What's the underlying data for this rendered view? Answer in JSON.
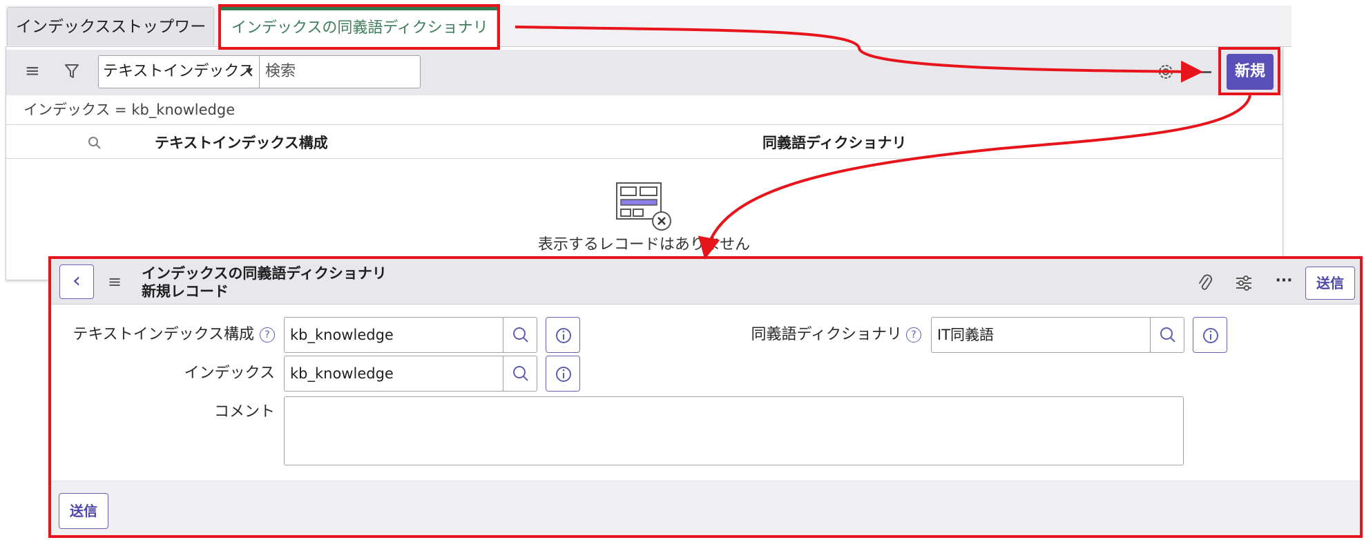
{
  "tabs": [
    {
      "label": "インデックスストップワード"
    },
    {
      "label": "インデックスの同義語ディクショナリ"
    }
  ],
  "list": {
    "search_field_value": "テキストインデックス",
    "search_placeholder": "検索",
    "new_button_label": "新規",
    "breadcrumb": "インデックス = kb_knowledge",
    "columns": [
      "テキストインデックス構成",
      "同義語ディクショナリ"
    ],
    "empty_message": "表示するレコードはありません"
  },
  "form": {
    "title": "インデックスの同義語ディクショナリ",
    "subtitle": "新規レコード",
    "submit_label": "送信",
    "fields": {
      "text_index_config": {
        "label": "テキストインデックス構成",
        "value": "kb_knowledge"
      },
      "synonym_dictionary": {
        "label": "同義語ディクショナリ",
        "value": "IT同義語"
      },
      "index": {
        "label": "インデックス",
        "value": "kb_knowledge"
      },
      "comment": {
        "label": "コメント",
        "value": ""
      }
    }
  },
  "icons": [
    "hamburger-icon",
    "filter-icon",
    "gear-icon",
    "minus-icon",
    "search-icon",
    "info-icon",
    "help-icon",
    "chevron-left-icon",
    "paperclip-icon",
    "sliders-icon",
    "more-icon",
    "empty-records-icon"
  ],
  "colors": {
    "accent": "#5a4fb8",
    "annotation": "#e8141b",
    "active_tab_text": "#3e7d5b"
  }
}
